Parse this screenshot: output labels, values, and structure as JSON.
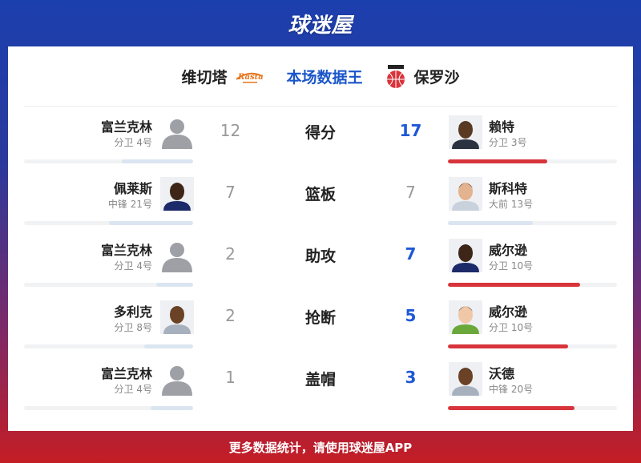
{
  "brand": {
    "logo_text": "球迷屋"
  },
  "header": {
    "home_team": "维切塔",
    "title": "本场数据王",
    "away_team": "保罗沙",
    "home_logo_text": "Rasta"
  },
  "rows": [
    {
      "stat": "得分",
      "left": {
        "name": "富兰克林",
        "pos": "分卫 4号",
        "value": "12",
        "avatar": "placeholder",
        "fill": 0.42
      },
      "right": {
        "name": "赖特",
        "pos": "分卫 3号",
        "value": "17",
        "avatar": "photo",
        "fill": 0.59,
        "lead": true
      }
    },
    {
      "stat": "篮板",
      "left": {
        "name": "佩莱斯",
        "pos": "中锋 21号",
        "value": "7",
        "avatar": "photo",
        "fill": 0.5
      },
      "right": {
        "name": "斯科特",
        "pos": "大前 13号",
        "value": "7",
        "avatar": "photo",
        "fill": 0.5,
        "lead": false
      }
    },
    {
      "stat": "助攻",
      "left": {
        "name": "富兰克林",
        "pos": "分卫 4号",
        "value": "2",
        "avatar": "placeholder",
        "fill": 0.22
      },
      "right": {
        "name": "威尔逊",
        "pos": "分卫 10号",
        "value": "7",
        "avatar": "photo",
        "fill": 0.78,
        "lead": true
      }
    },
    {
      "stat": "抢断",
      "left": {
        "name": "多利克",
        "pos": "分卫 8号",
        "value": "2",
        "avatar": "photo",
        "fill": 0.29
      },
      "right": {
        "name": "威尔逊",
        "pos": "分卫 10号",
        "value": "5",
        "avatar": "photo",
        "fill": 0.71,
        "lead": true
      }
    },
    {
      "stat": "盖帽",
      "left": {
        "name": "富兰克林",
        "pos": "分卫 4号",
        "value": "1",
        "avatar": "placeholder",
        "fill": 0.25
      },
      "right": {
        "name": "沃德",
        "pos": "中锋 20号",
        "value": "3",
        "avatar": "photo",
        "fill": 0.75,
        "lead": true
      }
    }
  ],
  "footer": {
    "text": "更多数据统计，请使用球迷屋APP"
  },
  "colors": {
    "lead_value": "#1f58d6",
    "lead_bar": "#d8343b",
    "other_bar": "#dbe5f1",
    "title": "#1a56c9"
  }
}
